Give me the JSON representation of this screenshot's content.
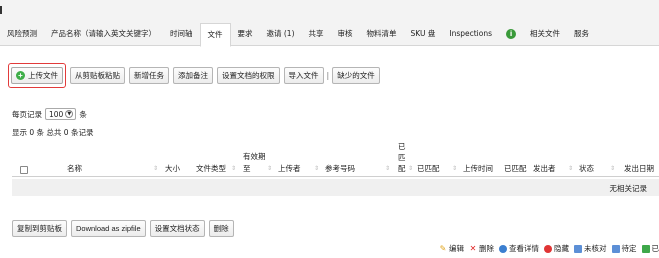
{
  "tabs": [
    {
      "label": "风险预测"
    },
    {
      "label": "产品名称（请输入英文关键字）"
    },
    {
      "label": "时间轴"
    },
    {
      "label": "文件",
      "active": true
    },
    {
      "label": "要求"
    },
    {
      "label": "邀请 (1)"
    },
    {
      "label": "共享"
    },
    {
      "label": "审核"
    },
    {
      "label": "物料清单"
    },
    {
      "label": "SKU 盘"
    },
    {
      "label": "Inspections"
    },
    {
      "label": "i",
      "icon": "info-icon"
    },
    {
      "label": "相关文件"
    },
    {
      "label": "服务"
    }
  ],
  "toolbar": {
    "upload": "上传文件",
    "paste": "从剪贴板粘贴",
    "new_task": "新增任务",
    "add_note": "添加备注",
    "permissions": "设置文档的权限",
    "import": "导入文件",
    "separator": "|",
    "missing": "缺少的文件"
  },
  "perpage": {
    "prefix": "每页记录",
    "value": "100",
    "suffix": "条"
  },
  "summary": "显示 0 条 总共 0 条记录",
  "table": {
    "headers": {
      "name": "名称",
      "size": "大小",
      "type": "文件类型",
      "valid_line1": "有效期",
      "valid_line2": "至",
      "uploader": "上传者",
      "ref": "参考号码",
      "matched_v1": "已",
      "matched_v2": "匹",
      "matched_v3": "配",
      "matched": "已匹配",
      "upload_time": "上传时间",
      "matched2": "已匹配",
      "sender": "发出者",
      "status": "状态",
      "sent_date": "发出日期"
    },
    "empty": "无相关记录"
  },
  "bottom": {
    "copy": "复制到剪贴板",
    "download": "Download as zipfile",
    "set_status": "设置文档状态",
    "delete": "删除"
  },
  "legend": {
    "edit": "编辑",
    "delete": "删除",
    "view": "查看详情",
    "hide": "隐藏",
    "unverified": "未核对",
    "pending": "待定",
    "done": "已"
  }
}
